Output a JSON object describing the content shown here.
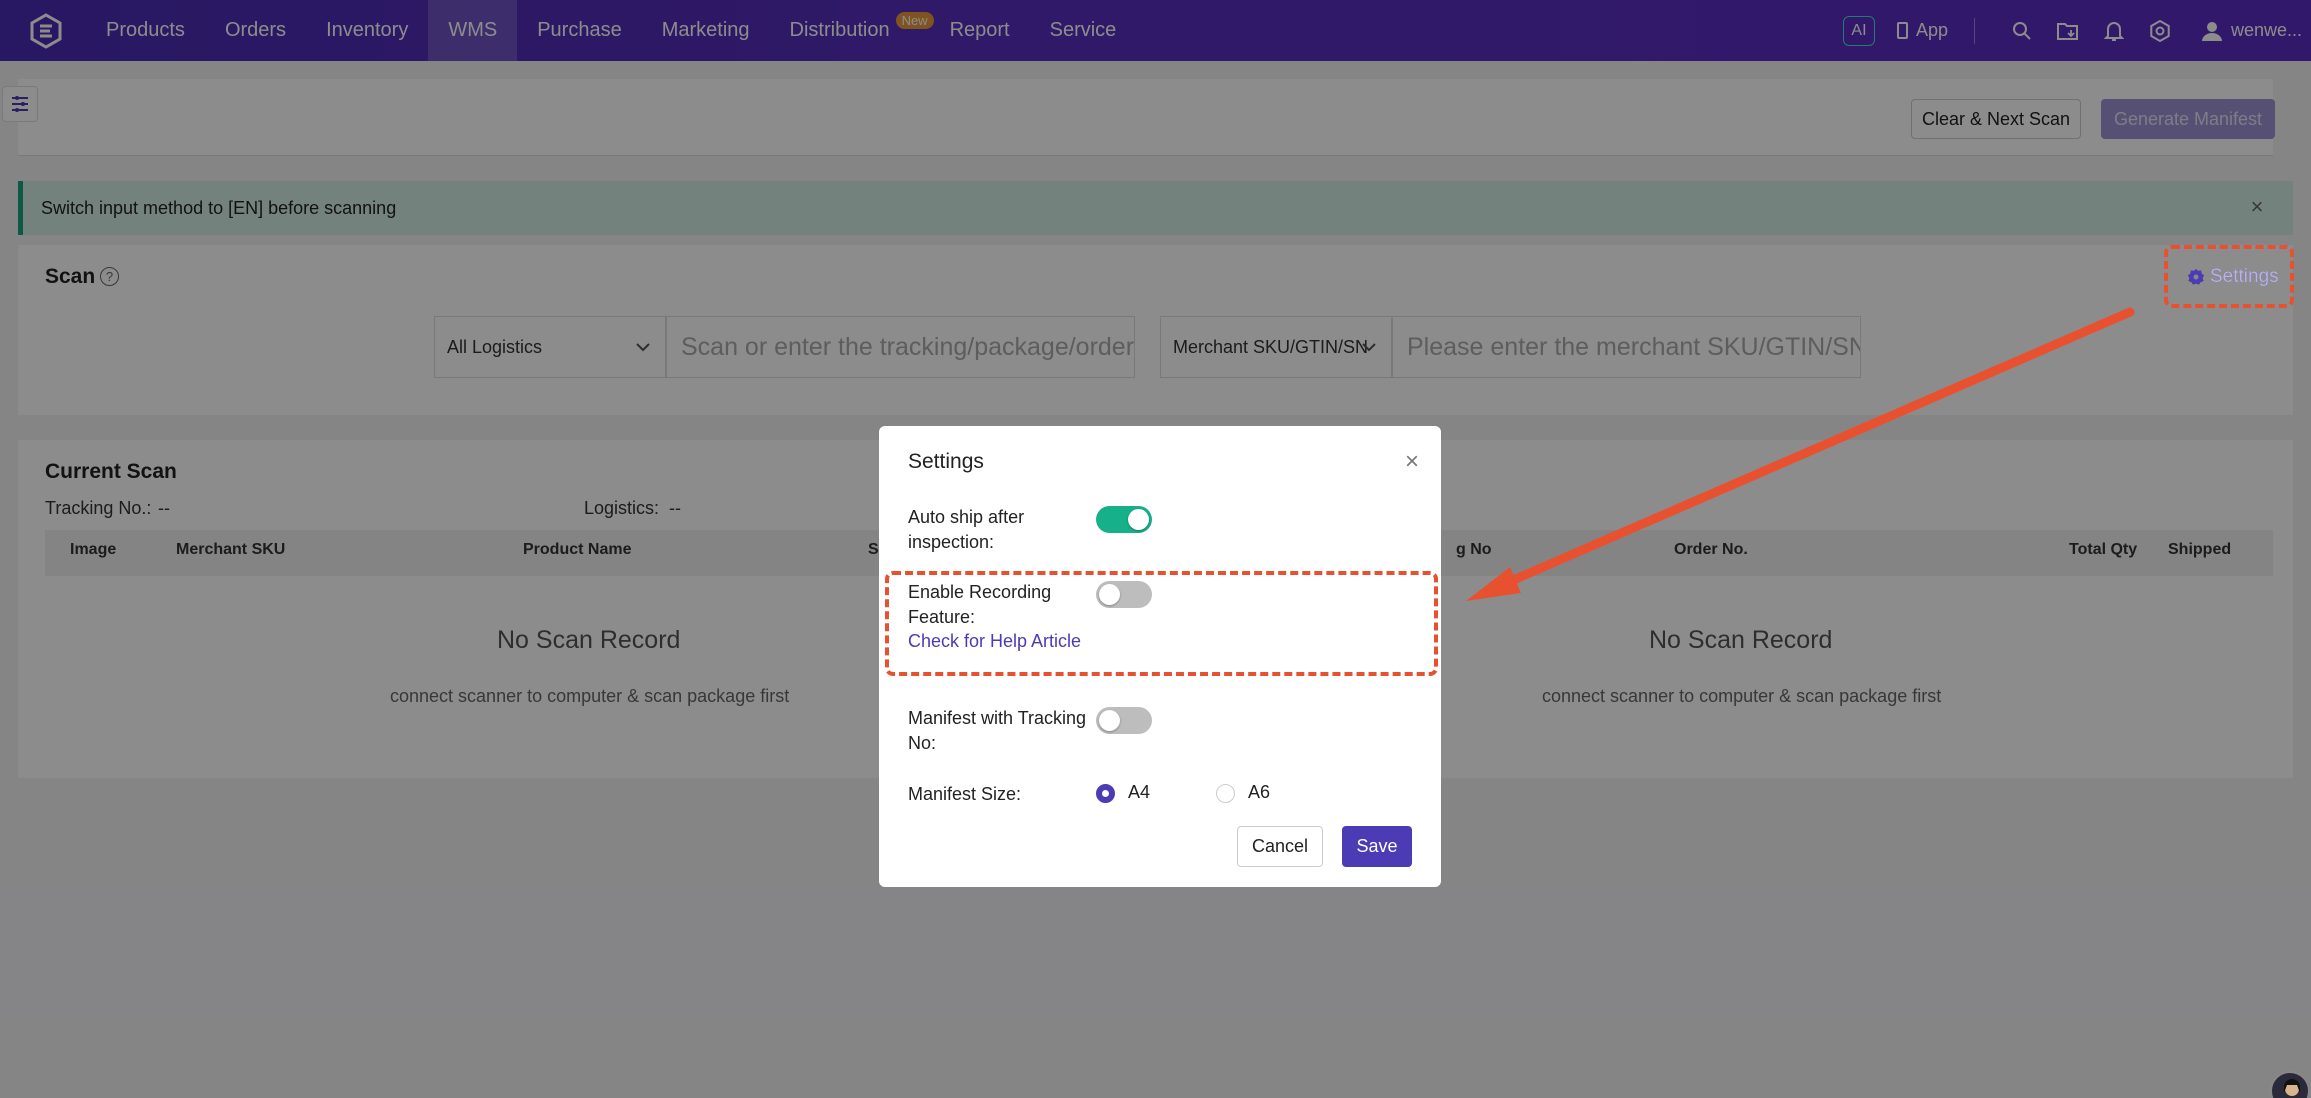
{
  "nav": {
    "items": [
      "Products",
      "Orders",
      "Inventory",
      "WMS",
      "Purchase",
      "Marketing",
      "Distribution",
      "Report",
      "Service"
    ],
    "active": "WMS",
    "new_badge": "New",
    "ai_label": "AI",
    "app_label": "App",
    "user_label": "wenwe..."
  },
  "toolbar": {
    "clear_label": "Clear & Next Scan",
    "generate_label": "Generate Manifest"
  },
  "alert": {
    "text": "Switch input method to [EN] before scanning",
    "close": "×"
  },
  "scan": {
    "title": "Scan",
    "help": "?",
    "settings_label": "Settings",
    "logistics_select": "All Logistics",
    "tracking_placeholder": "Scan or enter the tracking/package/order",
    "sku_select": "Merchant SKU/GTIN/SN",
    "sku_placeholder": "Please enter the merchant SKU/GTIN/SN"
  },
  "current_scan": {
    "title": "Current Scan",
    "tracking_label": "Tracking No.:",
    "tracking_value": "--",
    "logistics_label": "Logistics:",
    "logistics_value": "--",
    "columns_left": [
      "Image",
      "Merchant SKU",
      "Product Name",
      "S"
    ],
    "columns_right": [
      "g No",
      "Order No.",
      "Total Qty",
      "Shipped"
    ],
    "empty_title": "No Scan Record",
    "empty_sub": "connect scanner to computer & scan package first"
  },
  "modal": {
    "title": "Settings",
    "close": "×",
    "auto_ship_label": "Auto ship after inspection:",
    "auto_ship_on": true,
    "recording_label": "Enable Recording Feature:",
    "recording_on": false,
    "help_link": "Check for Help Article",
    "manifest_tracking_label": "Manifest with Tracking No:",
    "manifest_tracking_on": false,
    "manifest_size_label": "Manifest Size:",
    "size_options": [
      "A4",
      "A6"
    ],
    "size_selected": "A4",
    "cancel_label": "Cancel",
    "save_label": "Save"
  },
  "colors": {
    "brand": "#4b3bb5",
    "toggle_on": "#16b08a",
    "annotation": "#e8512f"
  }
}
